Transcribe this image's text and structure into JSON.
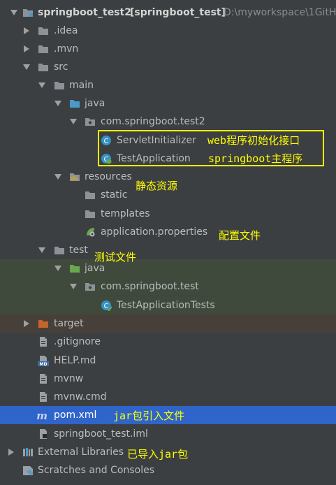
{
  "project": {
    "name": "springboot_test2",
    "module": "[springboot_test]",
    "path": "D:\\myworkspace\\1GitH"
  },
  "tree": {
    "idea": ".idea",
    "mvn": ".mvn",
    "src": "src",
    "main": "main",
    "java": "java",
    "pkg": "com.springboot.test2",
    "servlet": "ServletInitializer",
    "app": "TestApplication",
    "resources": "resources",
    "static": "static",
    "templates": "templates",
    "props": "application.properties",
    "test": "test",
    "test_java": "java",
    "test_pkg": "com.springboot.test",
    "test_class": "TestApplicationTests",
    "target": "target",
    "gitignore": ".gitignore",
    "help": "HELP.md",
    "mvnw": "mvnw",
    "mvnw_cmd": "mvnw.cmd",
    "pom": "pom.xml",
    "iml": "springboot_test.iml",
    "ext_libs": "External Libraries",
    "scratches": "Scratches and Consoles"
  },
  "annotations": {
    "servlet": "web程序初始化接口",
    "app": "springboot主程序",
    "resources": "静态资源",
    "props": "配置文件",
    "test": "测试文件",
    "pom": "jar包引入文件",
    "ext_libs": "已导入jar包"
  },
  "colors": {
    "background": "#3c3f41",
    "text": "#bbbbbb",
    "annotation": "#ffff00",
    "selection": "#2f65ca",
    "test_highlight": "#3f4a3d",
    "folder": "#8e9298",
    "source_folder": "#4a9ac9",
    "excluded_folder": "#c4652a"
  }
}
